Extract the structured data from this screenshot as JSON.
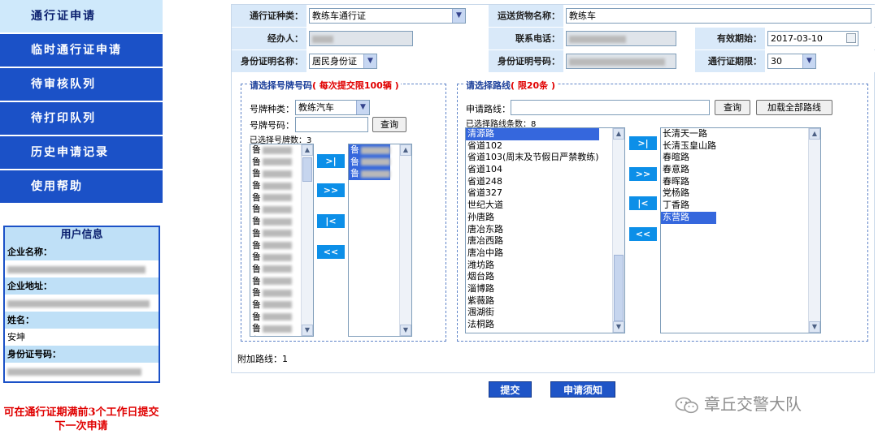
{
  "sidebar": {
    "nav": [
      {
        "label": "通行证申请",
        "active": true
      },
      {
        "label": "临时通行证申请",
        "active": false
      },
      {
        "label": "待审核队列",
        "active": false
      },
      {
        "label": "待打印队列",
        "active": false
      },
      {
        "label": "历史申请记录",
        "active": false
      },
      {
        "label": "使用帮助",
        "active": false
      }
    ],
    "user_info": {
      "title": "用户信息",
      "company_label": "企业名称：",
      "address_label": "企业地址：",
      "name_label": "姓名：",
      "name_value": "安坤",
      "id_label": "身份证号码："
    },
    "note": "可在通行证期满前3个工作日提交下一次申请"
  },
  "form": {
    "pass_type_label": "通行证种类：",
    "pass_type_value": "教练车通行证",
    "cargo_label": "运送货物名称：",
    "cargo_value": "教练车",
    "handler_label": "经办人：",
    "phone_label": "联系电话：",
    "valid_start_label": "有效期始：",
    "valid_start_value": "2017-03-10",
    "id_type_label": "身份证明名称：",
    "id_type_value": "居民身份证",
    "id_number_label": "身份证明号码：",
    "period_label": "通行证期限：",
    "period_value": "30"
  },
  "plates": {
    "title": "请选择号牌号码",
    "title_note": "( 每次提交限100辆 )",
    "plate_type_label": "号牌种类：",
    "plate_type_value": "教练汽车",
    "plate_no_label": "号牌号码：",
    "query_label": "查询",
    "selected_count": "已选择号牌数：3",
    "available_prefix": "鲁",
    "available_count": 17,
    "selected_prefix": "鲁",
    "selected_items_count": 3,
    "btn_move_one": ">|",
    "btn_move_all": ">>",
    "btn_remove_one": "|<",
    "btn_remove_all": "<<"
  },
  "routes": {
    "title": "请选择路线",
    "title_note": "( 限20条 )",
    "apply_label": "申请路线：",
    "query_label": "查询",
    "load_all_label": "加载全部路线",
    "selected_count": "已选择路线条数：8",
    "available": [
      "清源路",
      "省道102",
      "省道103(周末及节假日严禁教练)",
      "省道104",
      "省道248",
      "省道327",
      "世纪大道",
      "孙唐路",
      "唐冶东路",
      "唐冶西路",
      "唐冶中路",
      "潍坊路",
      "烟台路",
      "淄博路",
      "紫薇路",
      "涠湖街",
      "法桐路"
    ],
    "selected": [
      "长清天一路",
      "长清玉皇山路",
      "春暄路",
      "春意路",
      "春晖路",
      "党杨路",
      "丁香路",
      "东营路"
    ],
    "btn_move_one": ">|",
    "btn_move_all": ">>",
    "btn_remove_one": "|<",
    "btn_remove_all": "<<"
  },
  "extra_routes": "附加路线：1",
  "actions": {
    "submit_label": "提交",
    "notice_label": "申请须知"
  },
  "watermark": "章丘交警大队",
  "colors": {
    "nav_blue": "#1b51c7",
    "nav_active": "#cfe9fb",
    "label_bg": "#d9e9f9",
    "selection": "#3567dd",
    "move_button": "#0c8fe8",
    "note_red": "#e00000"
  }
}
